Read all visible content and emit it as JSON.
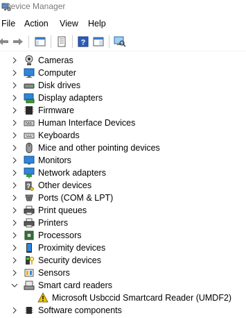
{
  "window": {
    "title": "Device Manager"
  },
  "menu": {
    "items": [
      "File",
      "Action",
      "View",
      "Help"
    ]
  },
  "toolbar": {
    "buttons": [
      {
        "name": "back-arrow-icon"
      },
      {
        "name": "forward-arrow-icon"
      },
      {
        "name": "show-hide-console-tree-icon"
      },
      {
        "name": "properties-icon"
      },
      {
        "name": "help-icon"
      },
      {
        "name": "action-pane-icon"
      },
      {
        "name": "scan-hardware-icon"
      }
    ]
  },
  "tree": {
    "items": [
      {
        "label": "Cameras",
        "icon": "camera-icon",
        "expanded": false
      },
      {
        "label": "Computer",
        "icon": "computer-icon",
        "expanded": false
      },
      {
        "label": "Disk drives",
        "icon": "disk-drive-icon",
        "expanded": false
      },
      {
        "label": "Display adapters",
        "icon": "display-adapter-icon",
        "expanded": false
      },
      {
        "label": "Firmware",
        "icon": "firmware-chip-icon",
        "expanded": false
      },
      {
        "label": "Human Interface Devices",
        "icon": "hid-keyboard-icon",
        "expanded": false
      },
      {
        "label": "Keyboards",
        "icon": "keyboard-icon",
        "expanded": false
      },
      {
        "label": "Mice and other pointing devices",
        "icon": "mouse-icon",
        "expanded": false
      },
      {
        "label": "Monitors",
        "icon": "monitor-icon",
        "expanded": false
      },
      {
        "label": "Network adapters",
        "icon": "network-adapter-icon",
        "expanded": false
      },
      {
        "label": "Other devices",
        "icon": "unknown-device-icon",
        "expanded": false
      },
      {
        "label": "Ports (COM & LPT)",
        "icon": "port-icon",
        "expanded": false
      },
      {
        "label": "Print queues",
        "icon": "print-queue-icon",
        "expanded": false
      },
      {
        "label": "Printers",
        "icon": "printer-icon",
        "expanded": false
      },
      {
        "label": "Processors",
        "icon": "processor-icon",
        "expanded": false
      },
      {
        "label": "Proximity devices",
        "icon": "proximity-device-icon",
        "expanded": false
      },
      {
        "label": "Security devices",
        "icon": "security-device-icon",
        "expanded": false
      },
      {
        "label": "Sensors",
        "icon": "sensor-icon",
        "expanded": false
      },
      {
        "label": "Smart card readers",
        "icon": "smart-card-reader-icon",
        "expanded": true,
        "children": [
          {
            "label": "Microsoft Usbccid Smartcard Reader (UMDF2)",
            "icon": "warning-icon"
          }
        ]
      },
      {
        "label": "Software components",
        "icon": "software-component-icon",
        "expanded": false
      }
    ]
  },
  "colors": {
    "title_text": "#7a7a7a",
    "accent_blue": "#1e73c8",
    "warning_yellow": "#f2c200"
  }
}
